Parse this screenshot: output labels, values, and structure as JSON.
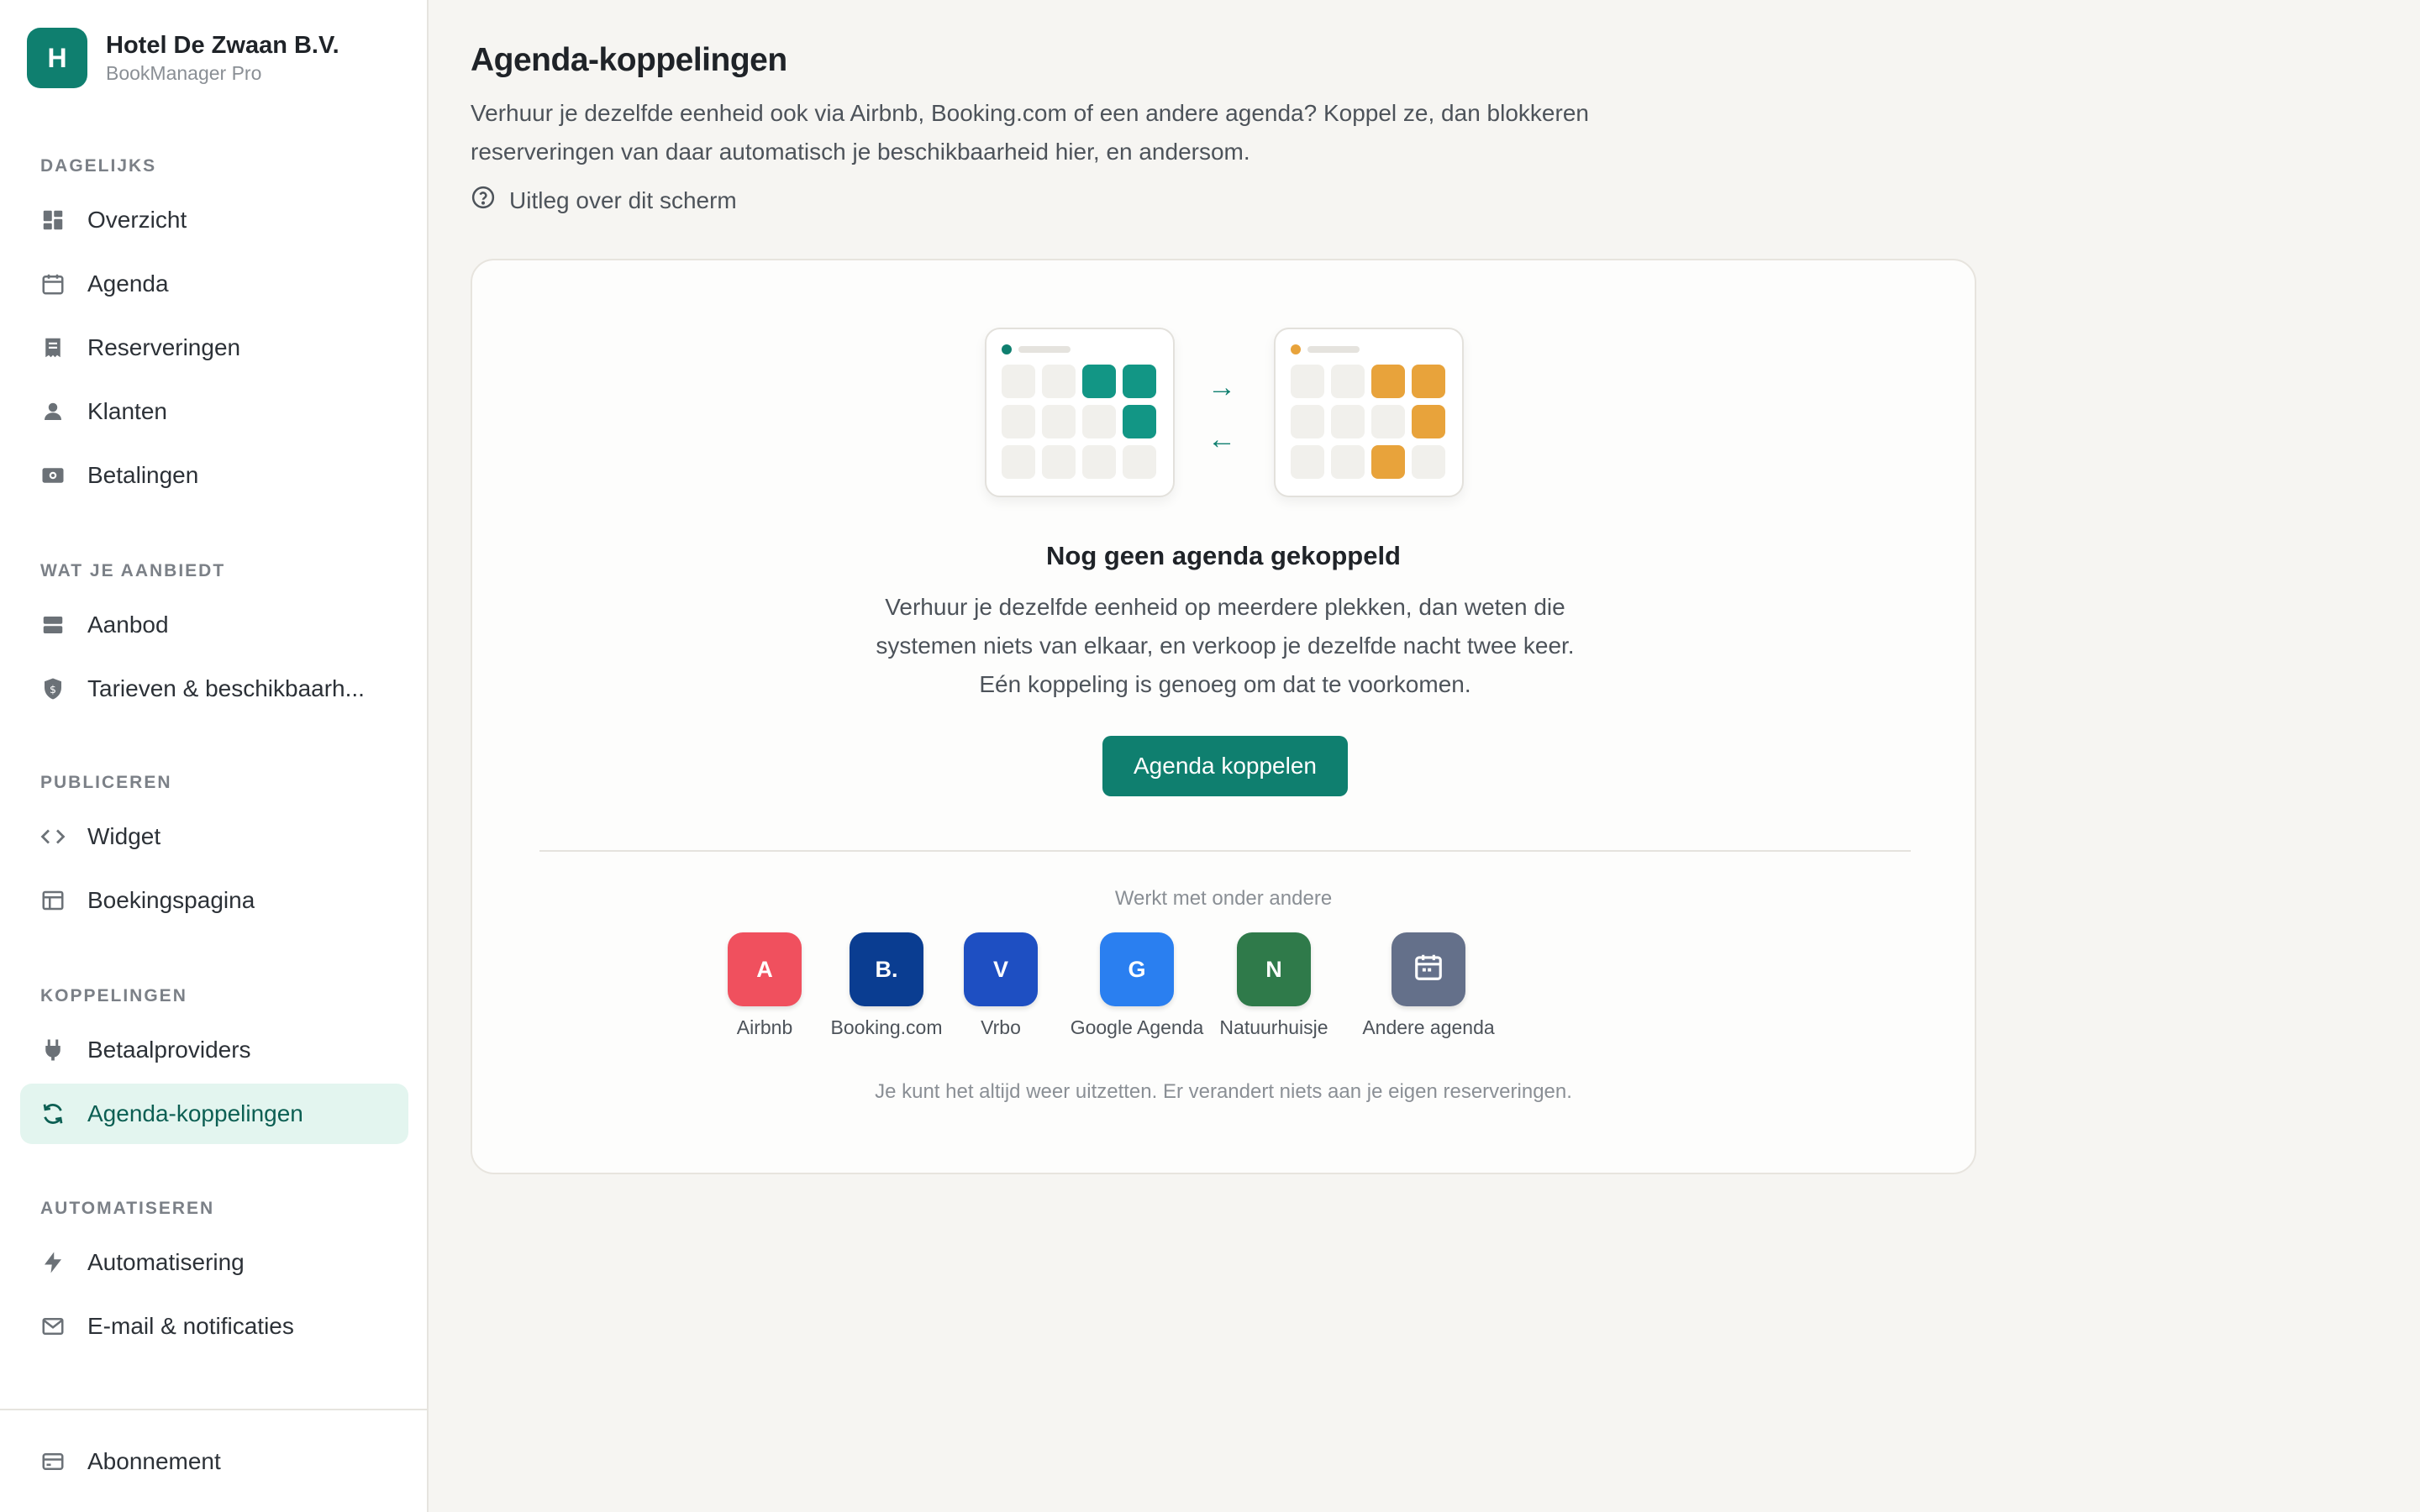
{
  "brand": {
    "initial": "H",
    "name": "Hotel De Zwaan B.V.",
    "product": "BookManager Pro"
  },
  "sidebar": {
    "sections": [
      {
        "title": "DAGELIJKS",
        "items": [
          {
            "label": "Overzicht",
            "icon": "dashboard-icon"
          },
          {
            "label": "Agenda",
            "icon": "calendar-icon"
          },
          {
            "label": "Reserveringen",
            "icon": "receipt-icon"
          },
          {
            "label": "Klanten",
            "icon": "person-icon"
          },
          {
            "label": "Betalingen",
            "icon": "money-icon"
          }
        ]
      },
      {
        "title": "WAT JE AANBIEDT",
        "items": [
          {
            "label": "Aanbod",
            "icon": "layers-icon"
          },
          {
            "label": "Tarieven & beschikbaarh...",
            "icon": "shield-icon"
          }
        ]
      },
      {
        "title": "PUBLICEREN",
        "items": [
          {
            "label": "Widget",
            "icon": "code-icon"
          },
          {
            "label": "Boekingspagina",
            "icon": "layout-icon"
          }
        ]
      },
      {
        "title": "KOPPELINGEN",
        "items": [
          {
            "label": "Betaalproviders",
            "icon": "plug-icon"
          },
          {
            "label": "Agenda-koppelingen",
            "icon": "sync-icon",
            "active": true
          }
        ]
      },
      {
        "title": "AUTOMATISEREN",
        "items": [
          {
            "label": "Automatisering",
            "icon": "bolt-icon"
          },
          {
            "label": "E-mail & notificaties",
            "icon": "mail-icon"
          }
        ]
      }
    ],
    "footer": {
      "label": "Abonnement",
      "icon": "card-icon"
    }
  },
  "main": {
    "title": "Agenda-koppelingen",
    "description": "Verhuur je dezelfde eenheid ook via Airbnb, Booking.com of een andere agenda? Koppel ze, dan blokkeren reserveringen van daar automatisch je beschikbaarheid hier, en andersom.",
    "help_link": "Uitleg over dit scherm",
    "empty_state": {
      "title": "Nog geen agenda gekoppeld",
      "lines": [
        "Verhuur je dezelfde eenheid op meerdere plekken, dan weten die",
        "systemen niets van elkaar, en verkoop je dezelfde nacht twee keer.",
        "Eén koppeling is genoeg om dat te voorkomen."
      ],
      "cta": "Agenda koppelen",
      "arrows": {
        "right": "→",
        "left": "←"
      },
      "works_with": "Werkt met onder andere",
      "providers": [
        {
          "initial": "A",
          "label": "Airbnb",
          "color": "#f0505e"
        },
        {
          "initial": "B.",
          "label": "Booking.com",
          "color": "#0a3d91"
        },
        {
          "initial": "V",
          "label": "Vrbo",
          "color": "#1e4fc2"
        },
        {
          "initial": "G",
          "label": "Google Agenda",
          "color": "#2a7ff0"
        },
        {
          "initial": "N",
          "label": "Natuurhuisje",
          "color": "#2f7a4a"
        },
        {
          "initial": "",
          "label": "Andere agenda",
          "color": "#64708a",
          "icon": "calendar-icon"
        }
      ],
      "footnote": "Je kunt het altijd weer uitzetten. Er verandert niets aan je eigen reserveringen."
    }
  },
  "colors": {
    "accent": "#0f7f6f",
    "accent_soft": "#e3f5ef",
    "orange": "#e8a33b"
  }
}
